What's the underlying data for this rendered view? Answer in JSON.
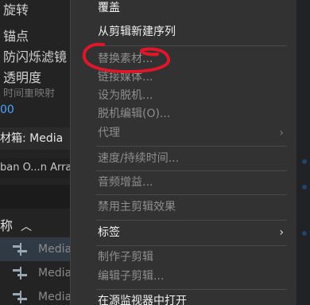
{
  "effect_controls": {
    "properties": [
      "旋转",
      "锚点",
      "防闪烁滤镜",
      "透明度",
      "时间重映射"
    ],
    "value_fragment": "00"
  },
  "project_panel": {
    "tab_label": "材箱: Media",
    "sub_label": "ban O...n Array",
    "column_header": "称",
    "items": [
      {
        "label": "Media",
        "selected": true
      },
      {
        "label": "Media",
        "selected": false
      },
      {
        "label": "Media",
        "selected": false
      }
    ]
  },
  "context_menu": {
    "items": [
      {
        "label": "覆盖",
        "enabled": true,
        "submenu": false
      },
      {
        "label": "从剪辑新建序列",
        "enabled": true,
        "submenu": false
      },
      {
        "label": "替换素材...",
        "enabled": false,
        "submenu": false
      },
      {
        "label": "链接媒体...",
        "enabled": false,
        "submenu": false
      },
      {
        "label": "设为脱机...",
        "enabled": false,
        "submenu": false
      },
      {
        "label": "脱机编辑(O)...",
        "enabled": false,
        "submenu": false
      },
      {
        "label": "代理",
        "enabled": false,
        "submenu": true
      },
      {
        "label": "速度/持续时间...",
        "enabled": false,
        "submenu": false
      },
      {
        "label": "音频增益...",
        "enabled": false,
        "submenu": false
      },
      {
        "label": "禁用主剪辑效果",
        "enabled": false,
        "submenu": false
      },
      {
        "label": "标签",
        "enabled": true,
        "submenu": true
      },
      {
        "label": "制作子剪辑",
        "enabled": false,
        "submenu": false
      },
      {
        "label": "编辑子剪辑...",
        "enabled": false,
        "submenu": false
      },
      {
        "label": "在源监视器中打开",
        "enabled": true,
        "submenu": false
      }
    ],
    "submenu_arrow": "›"
  },
  "colors": {
    "annotation_stroke": "#e0162b",
    "selection_bg": "#2f3a45",
    "accent_blue": "#4ea1ff"
  },
  "icons": {
    "sequence": "sequence-icon",
    "sort": "chevron-up-icon"
  }
}
